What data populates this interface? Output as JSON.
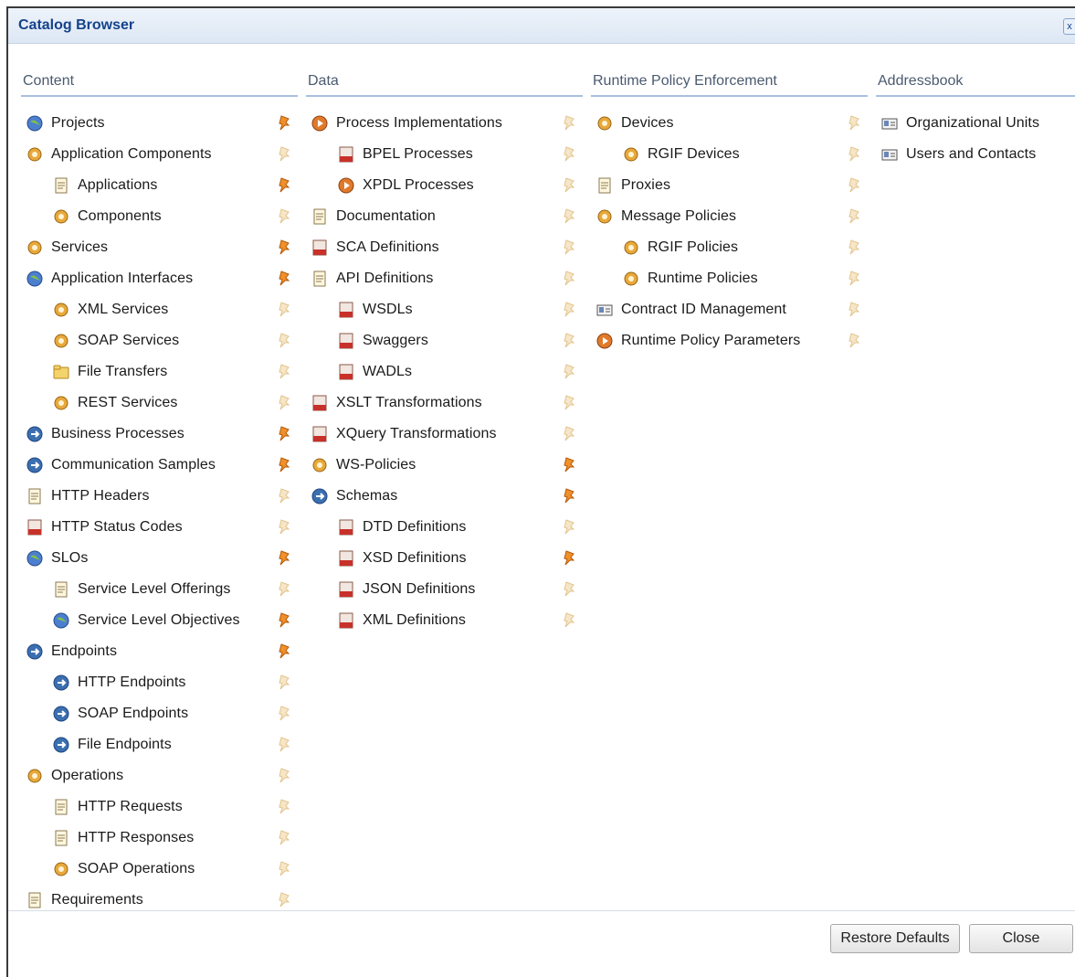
{
  "window": {
    "title": "Catalog Browser",
    "close_glyph": "x"
  },
  "colors": {
    "header_text": "#15428b",
    "divider": "#a8c1e0",
    "pin_active": "#f0902a",
    "pin_inactive": "#f6e6c8"
  },
  "columns": [
    {
      "header": "Content",
      "items": [
        {
          "label": "Projects",
          "level": 0,
          "icon": "projects-icon",
          "pinned": true
        },
        {
          "label": "Application Components",
          "level": 0,
          "icon": "application-components-icon",
          "pinned": false
        },
        {
          "label": "Applications",
          "level": 1,
          "icon": "applications-icon",
          "pinned": true
        },
        {
          "label": "Components",
          "level": 1,
          "icon": "components-icon",
          "pinned": false
        },
        {
          "label": "Services",
          "level": 0,
          "icon": "services-icon",
          "pinned": true
        },
        {
          "label": "Application Interfaces",
          "level": 0,
          "icon": "application-interfaces-icon",
          "pinned": true
        },
        {
          "label": "XML Services",
          "level": 1,
          "icon": "xml-services-icon",
          "pinned": false
        },
        {
          "label": "SOAP Services",
          "level": 1,
          "icon": "soap-services-icon",
          "pinned": false
        },
        {
          "label": "File Transfers",
          "level": 1,
          "icon": "file-transfers-icon",
          "pinned": false
        },
        {
          "label": "REST Services",
          "level": 1,
          "icon": "rest-services-icon",
          "pinned": false
        },
        {
          "label": "Business Processes",
          "level": 0,
          "icon": "business-processes-icon",
          "pinned": true
        },
        {
          "label": "Communication Samples",
          "level": 0,
          "icon": "communication-samples-icon",
          "pinned": true
        },
        {
          "label": "HTTP Headers",
          "level": 0,
          "icon": "http-headers-icon",
          "pinned": false
        },
        {
          "label": "HTTP Status Codes",
          "level": 0,
          "icon": "http-status-codes-icon",
          "pinned": false
        },
        {
          "label": "SLOs",
          "level": 0,
          "icon": "slos-icon",
          "pinned": true
        },
        {
          "label": "Service Level Offerings",
          "level": 1,
          "icon": "service-level-offerings-icon",
          "pinned": false
        },
        {
          "label": "Service Level Objectives",
          "level": 1,
          "icon": "service-level-objectives-icon",
          "pinned": true
        },
        {
          "label": "Endpoints",
          "level": 0,
          "icon": "endpoints-icon",
          "pinned": true
        },
        {
          "label": "HTTP Endpoints",
          "level": 1,
          "icon": "http-endpoints-icon",
          "pinned": false
        },
        {
          "label": "SOAP Endpoints",
          "level": 1,
          "icon": "soap-endpoints-icon",
          "pinned": false
        },
        {
          "label": "File Endpoints",
          "level": 1,
          "icon": "file-endpoints-icon",
          "pinned": false
        },
        {
          "label": "Operations",
          "level": 0,
          "icon": "operations-icon",
          "pinned": false
        },
        {
          "label": "HTTP Requests",
          "level": 1,
          "icon": "http-requests-icon",
          "pinned": false
        },
        {
          "label": "HTTP Responses",
          "level": 1,
          "icon": "http-responses-icon",
          "pinned": false
        },
        {
          "label": "SOAP Operations",
          "level": 1,
          "icon": "soap-operations-icon",
          "pinned": false
        },
        {
          "label": "Requirements",
          "level": 0,
          "icon": "requirements-icon",
          "pinned": false
        }
      ]
    },
    {
      "header": "Data",
      "items": [
        {
          "label": "Process Implementations",
          "level": 0,
          "icon": "process-implementations-icon",
          "pinned": false
        },
        {
          "label": "BPEL Processes",
          "level": 1,
          "icon": "bpel-processes-icon",
          "pinned": false
        },
        {
          "label": "XPDL Processes",
          "level": 1,
          "icon": "xpdl-processes-icon",
          "pinned": false
        },
        {
          "label": "Documentation",
          "level": 0,
          "icon": "documentation-icon",
          "pinned": false
        },
        {
          "label": "SCA Definitions",
          "level": 0,
          "icon": "sca-definitions-icon",
          "pinned": false
        },
        {
          "label": "API Definitions",
          "level": 0,
          "icon": "api-definitions-icon",
          "pinned": false
        },
        {
          "label": "WSDLs",
          "level": 1,
          "icon": "wsdls-icon",
          "pinned": false
        },
        {
          "label": "Swaggers",
          "level": 1,
          "icon": "swaggers-icon",
          "pinned": false
        },
        {
          "label": "WADLs",
          "level": 1,
          "icon": "wadls-icon",
          "pinned": false
        },
        {
          "label": "XSLT Transformations",
          "level": 0,
          "icon": "xslt-transformations-icon",
          "pinned": false
        },
        {
          "label": "XQuery Transformations",
          "level": 0,
          "icon": "xquery-transformations-icon",
          "pinned": false
        },
        {
          "label": "WS-Policies",
          "level": 0,
          "icon": "ws-policies-icon",
          "pinned": true
        },
        {
          "label": "Schemas",
          "level": 0,
          "icon": "schemas-icon",
          "pinned": true
        },
        {
          "label": "DTD Definitions",
          "level": 1,
          "icon": "dtd-definitions-icon",
          "pinned": false
        },
        {
          "label": "XSD Definitions",
          "level": 1,
          "icon": "xsd-definitions-icon",
          "pinned": true
        },
        {
          "label": "JSON Definitions",
          "level": 1,
          "icon": "json-definitions-icon",
          "pinned": false
        },
        {
          "label": "XML Definitions",
          "level": 1,
          "icon": "xml-definitions-icon",
          "pinned": false
        }
      ]
    },
    {
      "header": "Runtime Policy Enforcement",
      "items": [
        {
          "label": "Devices",
          "level": 0,
          "icon": "devices-icon",
          "pinned": false
        },
        {
          "label": "RGIF Devices",
          "level": 1,
          "icon": "rgif-devices-icon",
          "pinned": false
        },
        {
          "label": "Proxies",
          "level": 0,
          "icon": "proxies-icon",
          "pinned": false
        },
        {
          "label": "Message Policies",
          "level": 0,
          "icon": "message-policies-icon",
          "pinned": false
        },
        {
          "label": "RGIF Policies",
          "level": 1,
          "icon": "rgif-policies-icon",
          "pinned": false
        },
        {
          "label": "Runtime Policies",
          "level": 1,
          "icon": "runtime-policies-icon",
          "pinned": false
        },
        {
          "label": "Contract ID Management",
          "level": 0,
          "icon": "contract-id-management-icon",
          "pinned": false
        },
        {
          "label": "Runtime Policy Parameters",
          "level": 0,
          "icon": "runtime-policy-parameters-icon",
          "pinned": false
        }
      ]
    },
    {
      "header": "Addressbook",
      "items": [
        {
          "label": "Organizational Units",
          "level": 0,
          "icon": "organizational-units-icon",
          "pinned": null
        },
        {
          "label": "Users and Contacts",
          "level": 0,
          "icon": "users-and-contacts-icon",
          "pinned": null
        }
      ]
    }
  ],
  "footer": {
    "restore_label": "Restore Defaults",
    "close_label": "Close"
  }
}
